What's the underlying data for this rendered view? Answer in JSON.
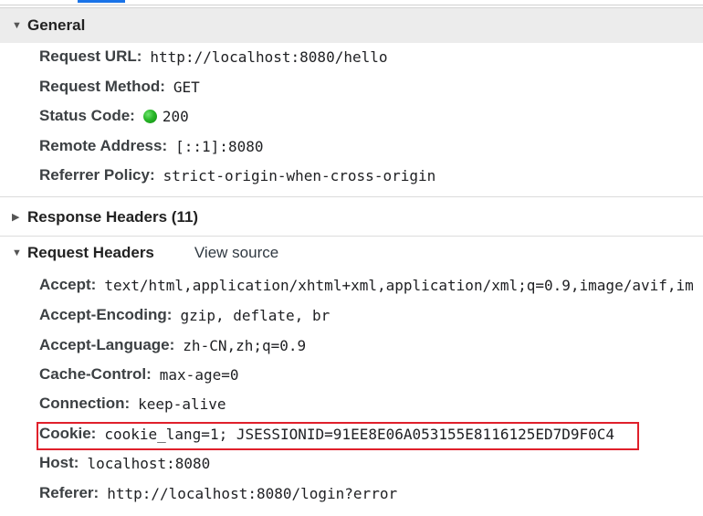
{
  "general": {
    "title": "General",
    "fields": [
      {
        "key": "Request URL:",
        "value": "http://localhost:8080/hello"
      },
      {
        "key": "Request Method:",
        "value": "GET"
      },
      {
        "key": "Status Code:",
        "value": "200",
        "status_color": "#27b627"
      },
      {
        "key": "Remote Address:",
        "value": "[::1]:8080"
      },
      {
        "key": "Referrer Policy:",
        "value": "strict-origin-when-cross-origin"
      }
    ]
  },
  "response_headers": {
    "title": "Response Headers (11)",
    "expanded": false
  },
  "request_headers": {
    "title": "Request Headers",
    "view_source": "View source",
    "expanded": true,
    "fields": [
      {
        "key": "Accept:",
        "value": "text/html,application/xhtml+xml,application/xml;q=0.9,image/avif,im"
      },
      {
        "key": "Accept-Encoding:",
        "value": "gzip, deflate, br"
      },
      {
        "key": "Accept-Language:",
        "value": "zh-CN,zh;q=0.9"
      },
      {
        "key": "Cache-Control:",
        "value": "max-age=0"
      },
      {
        "key": "Connection:",
        "value": "keep-alive"
      },
      {
        "key": "Cookie:",
        "value": "cookie_lang=1; JSESSIONID=91EE8E06A053155E8116125ED7D9F0C4"
      },
      {
        "key": "Host:",
        "value": "localhost:8080"
      },
      {
        "key": "Referer:",
        "value": "http://localhost:8080/login?error"
      }
    ]
  },
  "icons": {
    "expanded_caret": "caret-down-icon",
    "collapsed_caret": "caret-right-icon",
    "status": "status-dot-icon"
  },
  "colors": {
    "highlight_border": "#e0202b",
    "section_bg": "#ececec",
    "tab_accent": "#1a73e8"
  }
}
